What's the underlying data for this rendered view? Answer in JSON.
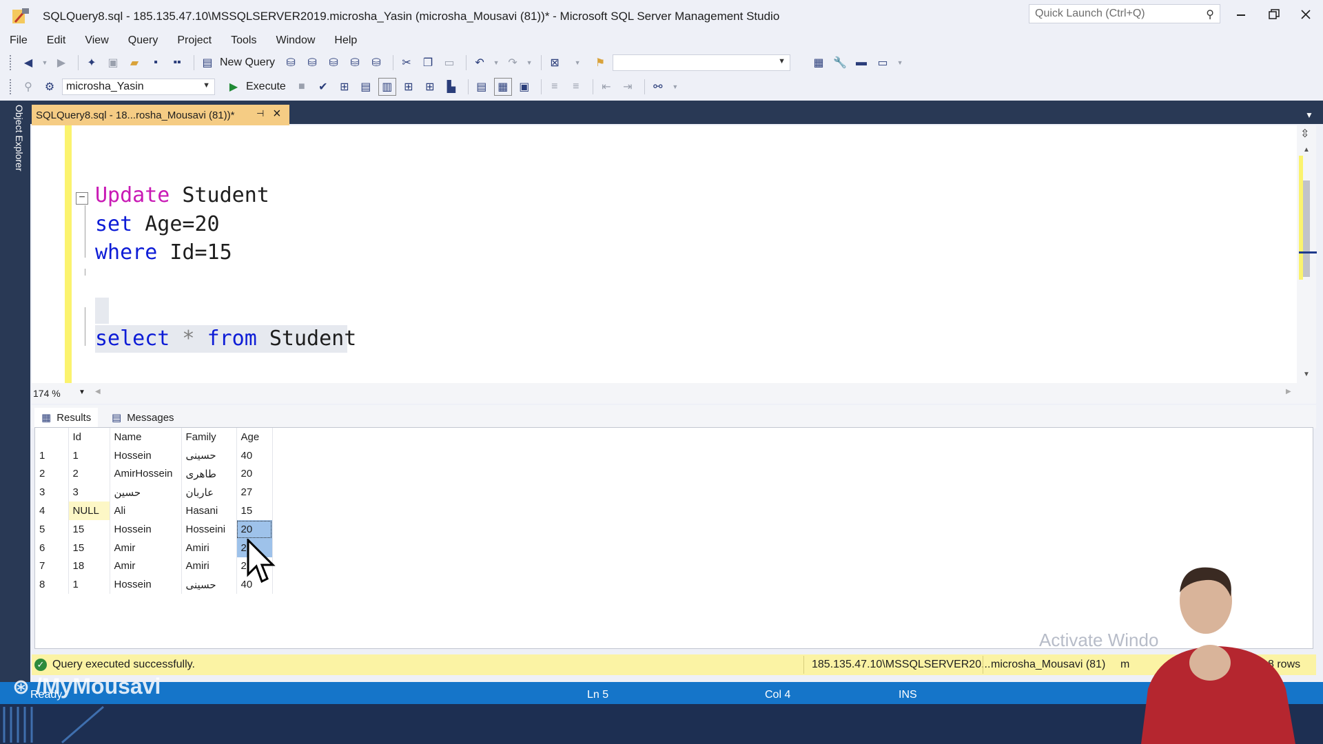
{
  "window": {
    "title": "SQLQuery8.sql - 185.135.47.10\\MSSQLSERVER2019.microsha_Yasin (microsha_Mousavi (81))* - Microsoft SQL Server Management Studio",
    "quick_launch_placeholder": "Quick Launch (Ctrl+Q)"
  },
  "menu": [
    "File",
    "Edit",
    "View",
    "Query",
    "Project",
    "Tools",
    "Window",
    "Help"
  ],
  "toolbar": {
    "new_query_label": "New Query",
    "execute_label": "Execute",
    "database_selected": "microsha_Yasin",
    "solution_config_value": ""
  },
  "sidebar": {
    "object_explorer_label": "Object Explorer"
  },
  "document_tab": {
    "label": "SQLQuery8.sql - 18...rosha_Mousavi (81))*"
  },
  "editor": {
    "line1_kw": "Update",
    "line1_rest": " Student",
    "line2_kw": "set",
    "line2_rest": " Age=20",
    "line3_kw": "where",
    "line3_rest": " Id=15",
    "line4_kw": "select",
    "line4_star": " * ",
    "line4_kw2": "from",
    "line4_rest": " Student",
    "zoom": "174 %"
  },
  "results": {
    "tab_results": "Results",
    "tab_messages": "Messages",
    "columns": [
      "Id",
      "Name",
      "Family",
      "Age"
    ],
    "rows": [
      {
        "rn": "1",
        "id": "1",
        "name": "Hossein",
        "family": "حسینی",
        "age": "40"
      },
      {
        "rn": "2",
        "id": "2",
        "name": "AmirHossein",
        "family": "طاهری",
        "age": "20"
      },
      {
        "rn": "3",
        "id": "3",
        "name": "حسین",
        "family": "عاربان",
        "age": "27"
      },
      {
        "rn": "4",
        "id": "NULL",
        "name": "Ali",
        "family": "Hasani",
        "age": "15"
      },
      {
        "rn": "5",
        "id": "15",
        "name": "Hossein",
        "family": "Hosseini",
        "age": "20"
      },
      {
        "rn": "6",
        "id": "15",
        "name": "Amir",
        "family": "Amiri",
        "age": "20"
      },
      {
        "rn": "7",
        "id": "18",
        "name": "Amir",
        "family": "Amiri",
        "age": "2"
      },
      {
        "rn": "8",
        "id": "1",
        "name": "Hossein",
        "family": "حسینی",
        "age": "40"
      }
    ]
  },
  "query_status": {
    "message": "Query executed successfully.",
    "server": "185.135.47.10\\MSSQLSERVER20...",
    "user": "microsha_Mousavi (81)",
    "user_trail": "m",
    "rows": "8 rows"
  },
  "status_bar": {
    "state": "Ready",
    "ln": "Ln 5",
    "col": "Col 4",
    "mode": "INS"
  },
  "overlay": {
    "channel_watermark": "/MyMousavi",
    "activate_windows": "Activate Windo"
  },
  "colors": {
    "tab_active": "#f5cc84",
    "keyword_pink": "#c91ab5",
    "keyword_blue": "#0d1cd6",
    "status_yellow": "#fbf3a4",
    "statusbar_blue": "#1575c9",
    "selection_blue": "#9ec2ea"
  }
}
